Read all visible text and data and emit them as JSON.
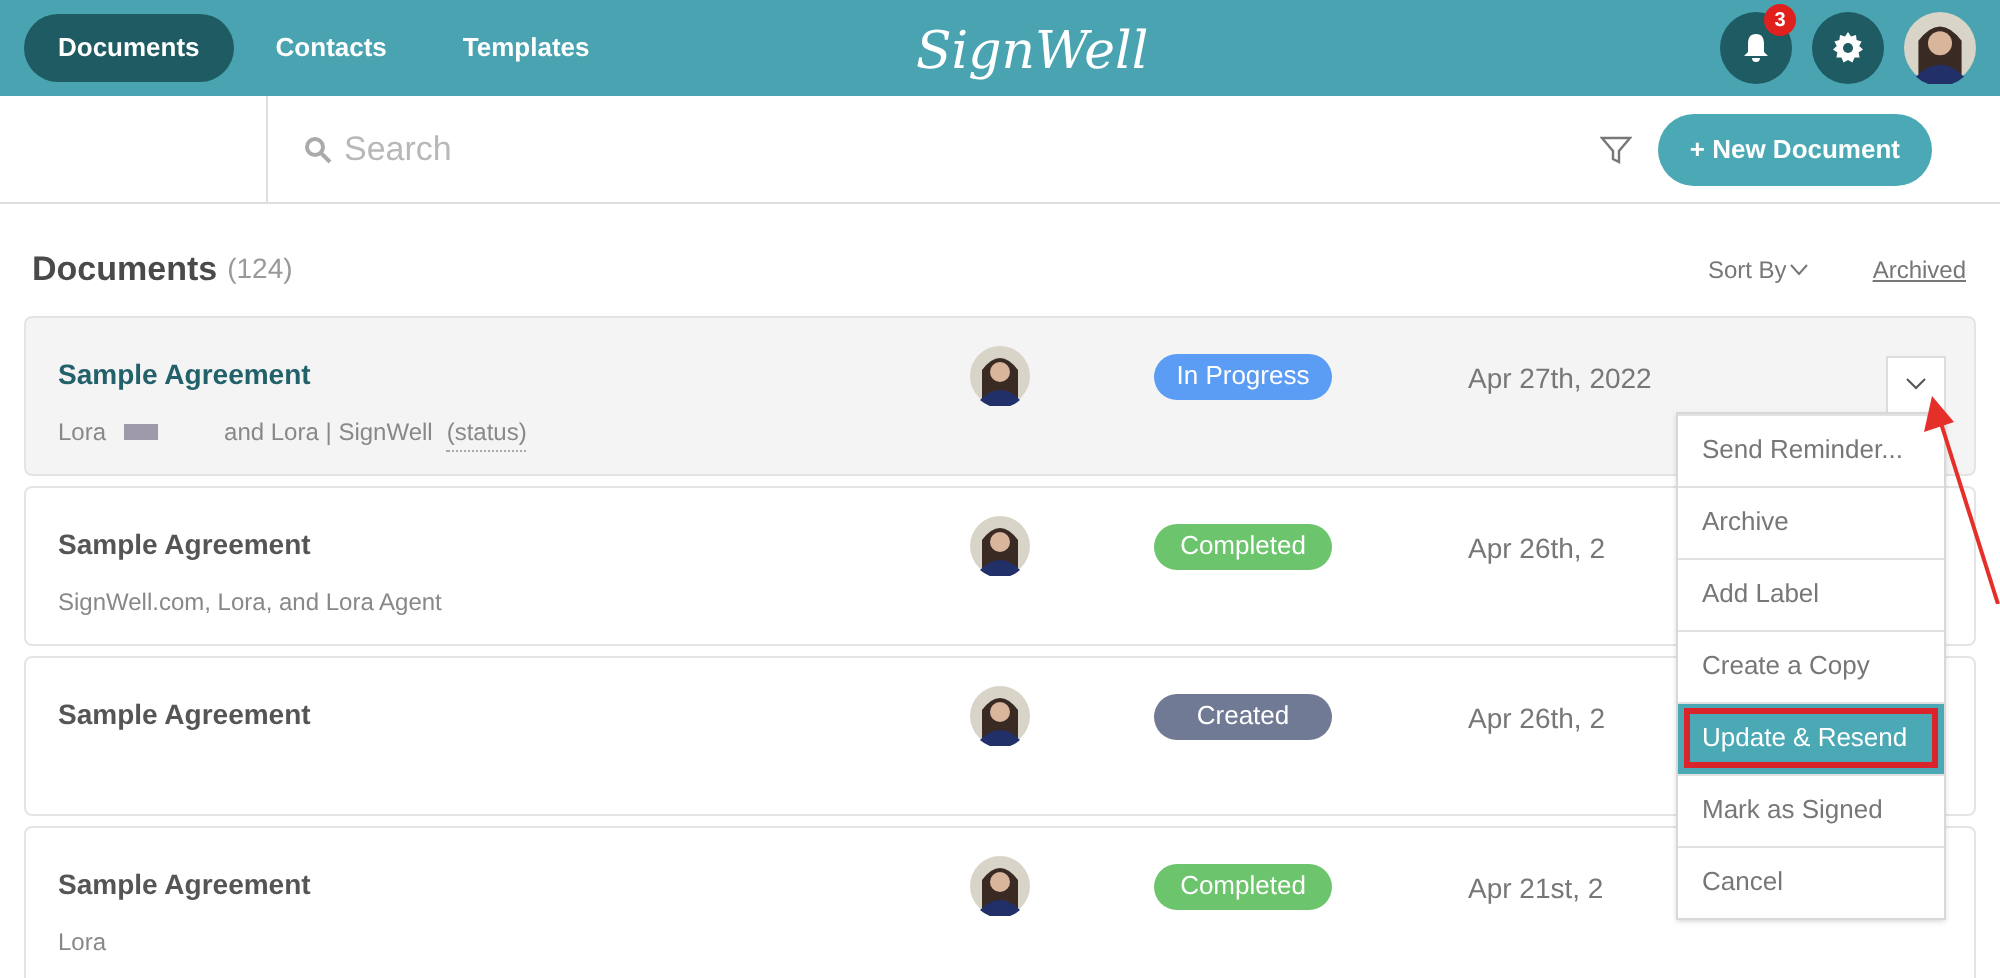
{
  "nav": {
    "tabs": [
      {
        "label": "Documents",
        "selected": true
      },
      {
        "label": "Contacts",
        "selected": false
      },
      {
        "label": "Templates",
        "selected": false
      }
    ],
    "logo": "SignWell",
    "notifications": "3"
  },
  "toolbar": {
    "search": {
      "placeholder": "Search"
    },
    "new_button": "+ New Document"
  },
  "header": {
    "title": "Documents",
    "count": "(124)",
    "sort": "Sort By",
    "archived": "Archived"
  },
  "documents": [
    {
      "title": "Sample Agreement",
      "recipients": [
        "Lora",
        "and Lora | SignWell"
      ],
      "redacted": true,
      "status_link": "(status)",
      "status": "In Progress",
      "color": "#5b9cf5",
      "date": "Apr 27th, 2022",
      "selected": true
    },
    {
      "title": "Sample Agreement",
      "recipients": [
        "SignWell.com, Lora, and Lora Agent"
      ],
      "status": "Completed",
      "color": "#6cc56c",
      "date": "Apr 26th, 2",
      "selected": false
    },
    {
      "title": "Sample Agreement",
      "status": "Created",
      "color": "#717a94",
      "date": "Apr 26th, 2",
      "selected": false
    },
    {
      "title": "Sample Agreement",
      "recipients": [
        "Lora"
      ],
      "status": "Completed",
      "color": "#6cc56c",
      "date": "Apr 21st, 2",
      "selected": false
    }
  ],
  "menu": {
    "items": [
      {
        "label": "Send Reminder...",
        "selected": false,
        "outlined": false
      },
      {
        "label": "Archive",
        "selected": false,
        "outlined": false
      },
      {
        "label": "Add Label",
        "selected": false,
        "outlined": false
      },
      {
        "label": "Create a Copy",
        "selected": false,
        "outlined": false
      },
      {
        "label": "Update & Resend",
        "selected": true,
        "outlined": true
      },
      {
        "label": "Mark as Signed",
        "selected": false,
        "outlined": false
      },
      {
        "label": "Cancel",
        "selected": false,
        "outlined": false
      }
    ],
    "pointer_arrow": true
  }
}
